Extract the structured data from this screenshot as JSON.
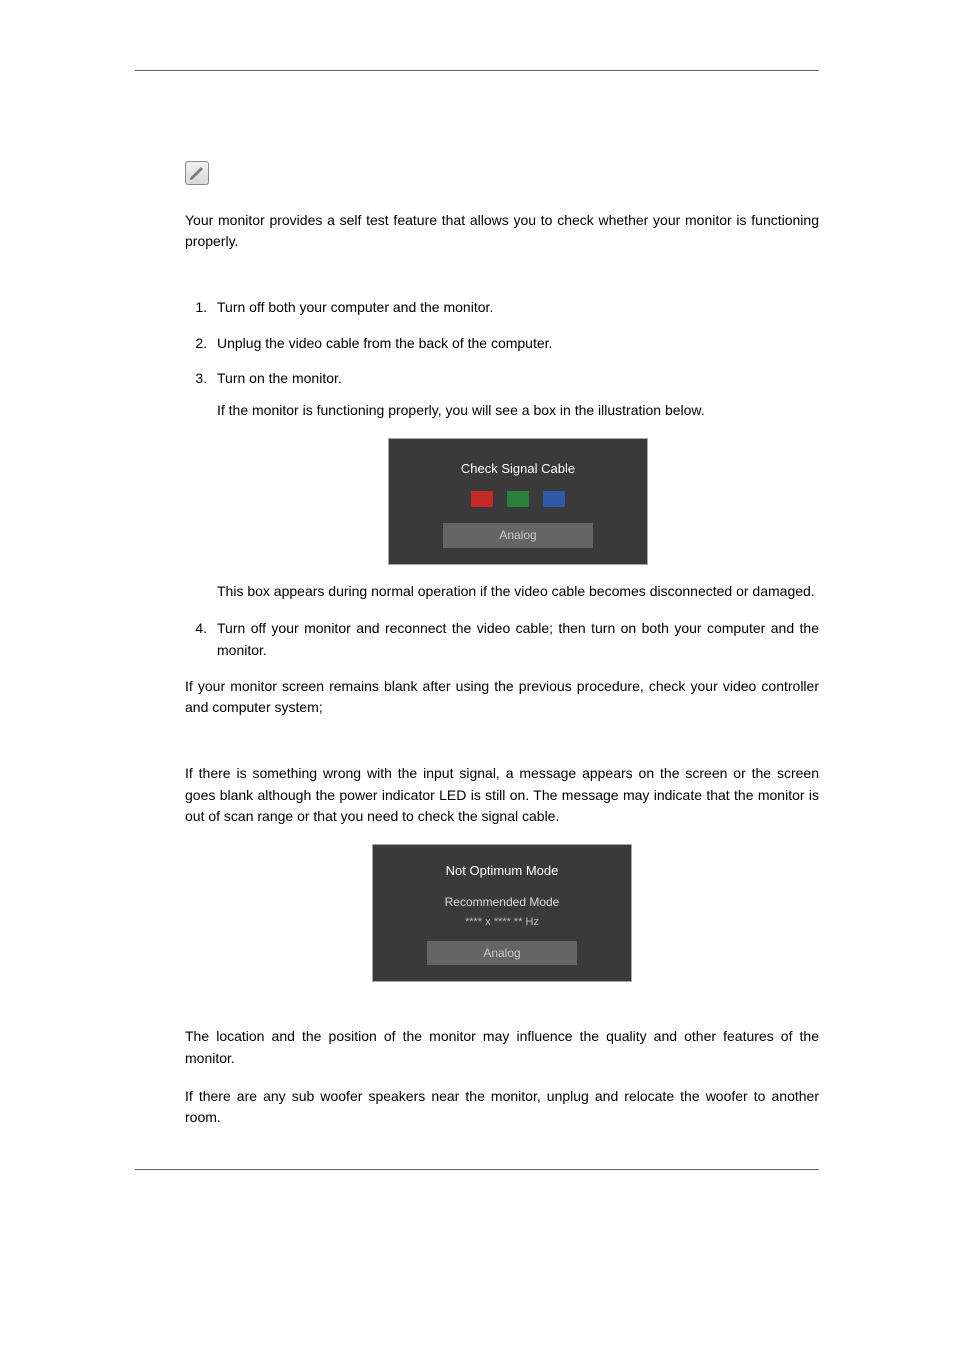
{
  "intro": {
    "p1": "Your monitor provides a self test feature that allows you to check whether your monitor is functioning properly."
  },
  "steps": {
    "s1": "Turn off both your computer and the monitor.",
    "s2": "Unplug the video cable from the back of the computer.",
    "s3": "Turn on the monitor.",
    "s3_after1": "If the monitor is functioning properly, you will see a box in the illustration below.",
    "s3_after2": "This box appears during normal operation if the video cable becomes disconnected or damaged.",
    "s4": "Turn off your monitor and reconnect the video cable; then turn on both your computer and the monitor."
  },
  "post_steps": {
    "p1": "If your monitor screen remains blank after using the previous procedure, check your video controller and computer system;"
  },
  "warning": {
    "p1": "If there is something wrong with the input signal, a message appears on the screen or the screen goes blank although the power indicator LED is still on. The message may indicate that the monitor is out of scan range or that you need to check the signal cable."
  },
  "environment": {
    "p1": "The location and the position of the monitor may influence the quality and other features of the monitor.",
    "p2": "If there are any sub woofer speakers near the monitor, unplug and relocate the woofer to another room."
  },
  "osd1": {
    "title": "Check Signal Cable",
    "mode": "Analog"
  },
  "osd2": {
    "title": "Not  Optimum Mode",
    "subtitle": "Recommended Mode",
    "meta": "**** x ****    ** Hz",
    "mode": "Analog"
  }
}
